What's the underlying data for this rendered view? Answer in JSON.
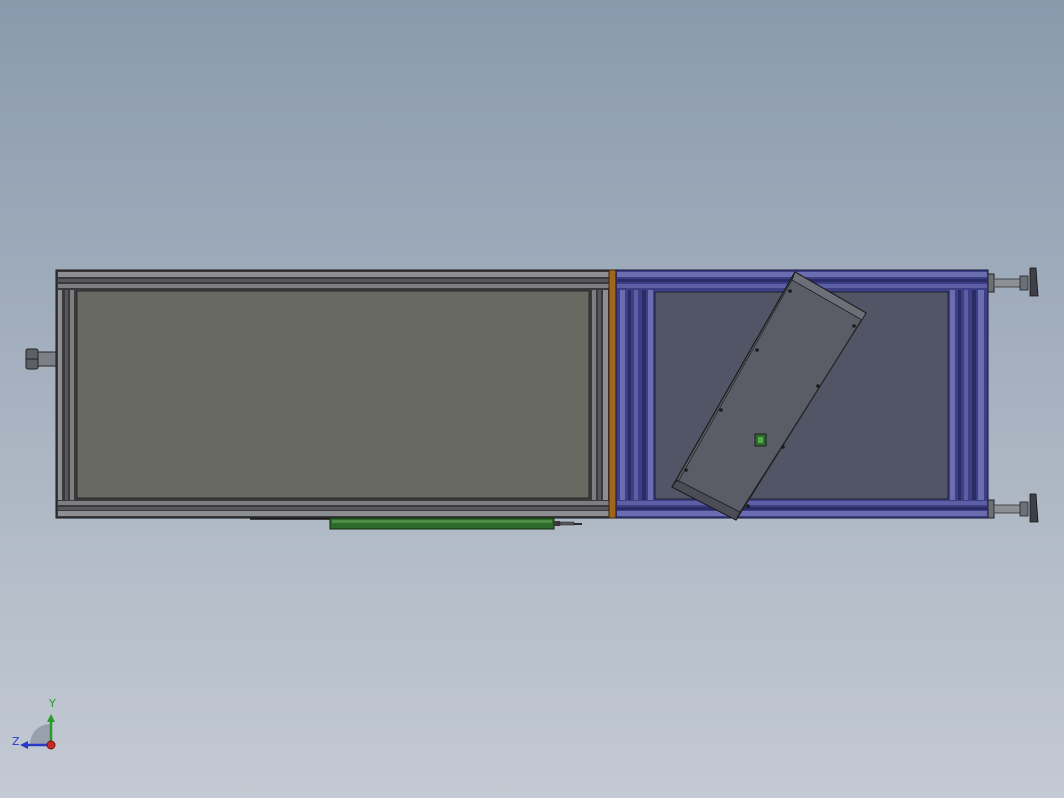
{
  "viewport": {
    "background_top": "#8a9aad",
    "background_bottom": "#c4cad3"
  },
  "model": {
    "left_frame_color": "#3a3a3c",
    "left_panel_color": "#686a62",
    "divider_color": "#a0661c",
    "right_frame_color": "#3c3f86",
    "right_panel_color": "#525566",
    "tilted_plate_color": "#5a5d66",
    "actuator_color": "#2e6a2a",
    "leveling_foot_color": "#6e7078"
  },
  "triad": {
    "y_label": "Y",
    "z_label": "Z",
    "y_color": "#2a9a2a",
    "z_color": "#2a3ac8",
    "x_color": "#c82a2a",
    "icons": [
      "y-axis-arrow-icon",
      "z-axis-arrow-icon",
      "x-axis-origin-icon"
    ]
  }
}
